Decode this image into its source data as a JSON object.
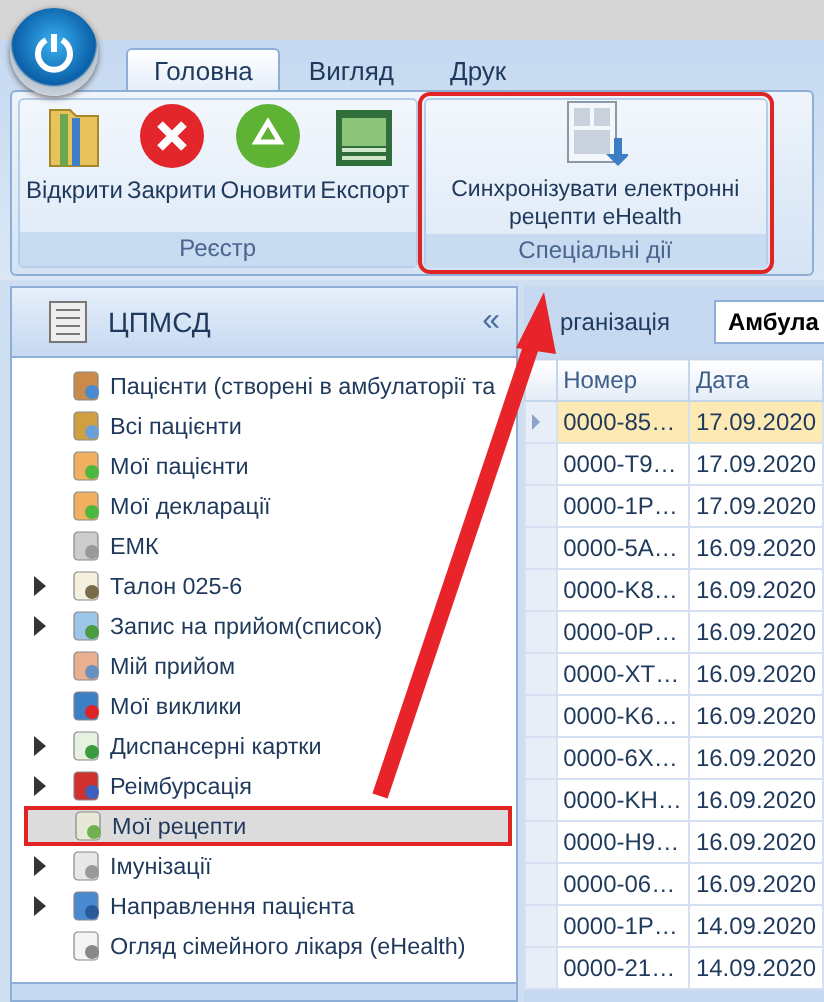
{
  "ribbon": {
    "tabs": [
      {
        "label": "Головна",
        "selected": true
      },
      {
        "label": "Вигляд",
        "selected": false
      },
      {
        "label": "Друк",
        "selected": false
      }
    ],
    "groups": [
      {
        "label": "Реєстр",
        "highlighted": false,
        "buttons": [
          "Відкрити",
          "Закрити",
          "Оновити",
          "Експорт"
        ]
      },
      {
        "label": "Спеціальні дії",
        "highlighted": true,
        "buttons": [
          "Синхронізувати електронні рецепти eHealth"
        ]
      }
    ]
  },
  "navigator": {
    "title": "ЦПМСД",
    "collapse": "«",
    "items": [
      {
        "label": "Пацієнти (створені в амбулаторії та",
        "kind": "leaf",
        "selected": false
      },
      {
        "label": "Всі пацієнти",
        "kind": "leaf",
        "selected": false
      },
      {
        "label": "Мої пацієнти",
        "kind": "leaf",
        "selected": false
      },
      {
        "label": "Мої декларації",
        "kind": "leaf",
        "selected": false
      },
      {
        "label": "ЕМК",
        "kind": "leaf",
        "selected": false
      },
      {
        "label": "Талон 025-6",
        "kind": "group",
        "selected": false
      },
      {
        "label": "Запис на прийом(список)",
        "kind": "group",
        "selected": false
      },
      {
        "label": "Мій прийом",
        "kind": "leaf",
        "selected": false
      },
      {
        "label": "Мої виклики",
        "kind": "leaf",
        "selected": false
      },
      {
        "label": "Диспансерні картки",
        "kind": "group",
        "selected": false
      },
      {
        "label": "Реімбурсація",
        "kind": "group",
        "selected": false
      },
      {
        "label": "Мої рецепти",
        "kind": "leaf",
        "selected": true,
        "highlighted": true
      },
      {
        "label": "Імунізації",
        "kind": "group",
        "selected": false
      },
      {
        "label": "Направлення пацієнта",
        "kind": "group",
        "selected": false
      },
      {
        "label": "Огляд сімейного лікаря (eHealth)",
        "kind": "leaf",
        "selected": false
      }
    ]
  },
  "grid": {
    "filter_label": "рганізація",
    "filter_value": "Амбула",
    "columns": [
      "Номер",
      "Дата"
    ],
    "rows": [
      {
        "cells": [
          "0000-85…",
          "17.09.2020"
        ],
        "selected": true
      },
      {
        "cells": [
          "0000-T9…",
          "17.09.2020"
        ],
        "selected": false
      },
      {
        "cells": [
          "0000-1P…",
          "17.09.2020"
        ],
        "selected": false
      },
      {
        "cells": [
          "0000-5A…",
          "16.09.2020"
        ],
        "selected": false
      },
      {
        "cells": [
          "0000-K8…",
          "16.09.2020"
        ],
        "selected": false
      },
      {
        "cells": [
          "0000-0P…",
          "16.09.2020"
        ],
        "selected": false
      },
      {
        "cells": [
          "0000-XT…",
          "16.09.2020"
        ],
        "selected": false
      },
      {
        "cells": [
          "0000-K6…",
          "16.09.2020"
        ],
        "selected": false
      },
      {
        "cells": [
          "0000-6X…",
          "16.09.2020"
        ],
        "selected": false
      },
      {
        "cells": [
          "0000-KH…",
          "16.09.2020"
        ],
        "selected": false
      },
      {
        "cells": [
          "0000-H9…",
          "16.09.2020"
        ],
        "selected": false
      },
      {
        "cells": [
          "0000-06…",
          "16.09.2020"
        ],
        "selected": false
      },
      {
        "cells": [
          "0000-1P…",
          "14.09.2020"
        ],
        "selected": false
      },
      {
        "cells": [
          "0000-21…",
          "14.09.2020"
        ],
        "selected": false
      }
    ]
  }
}
